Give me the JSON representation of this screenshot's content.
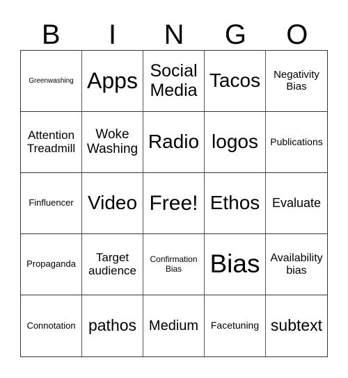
{
  "header": [
    "B",
    "I",
    "N",
    "G",
    "O"
  ],
  "cells": [
    {
      "text": "Greenwashing",
      "size": 10
    },
    {
      "text": "Apps",
      "size": 32
    },
    {
      "text": "Social Media",
      "size": 25
    },
    {
      "text": "Tacos",
      "size": 28
    },
    {
      "text": "Negativity Bias",
      "size": 15
    },
    {
      "text": "Attention Treadmill",
      "size": 17
    },
    {
      "text": "Woke Washing",
      "size": 19
    },
    {
      "text": "Radio",
      "size": 28
    },
    {
      "text": "logos",
      "size": 28
    },
    {
      "text": "Publications",
      "size": 14
    },
    {
      "text": "Finfluencer",
      "size": 13
    },
    {
      "text": "Video",
      "size": 28
    },
    {
      "text": "Free!",
      "size": 30
    },
    {
      "text": "Ethos",
      "size": 28
    },
    {
      "text": "Evaluate",
      "size": 18
    },
    {
      "text": "Propaganda",
      "size": 13
    },
    {
      "text": "Target audience",
      "size": 17
    },
    {
      "text": "Confirmation Bias",
      "size": 12
    },
    {
      "text": "Bias",
      "size": 37
    },
    {
      "text": "Availability bias",
      "size": 16
    },
    {
      "text": "Connotation",
      "size": 13
    },
    {
      "text": "pathos",
      "size": 23
    },
    {
      "text": "Medium",
      "size": 20
    },
    {
      "text": "Facetuning",
      "size": 14
    },
    {
      "text": "subtext",
      "size": 23
    }
  ]
}
